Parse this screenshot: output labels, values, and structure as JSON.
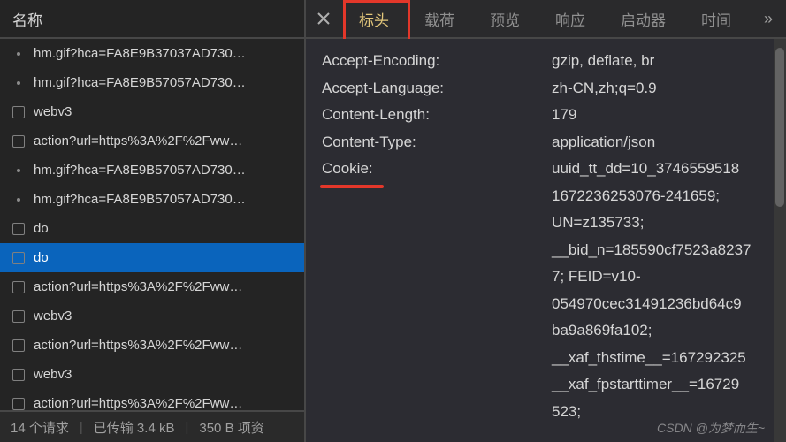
{
  "left": {
    "header": "名称",
    "requests": [
      {
        "icon": "dot",
        "name": "hm.gif?hca=FA8E9B37037AD730…"
      },
      {
        "icon": "dot",
        "name": "hm.gif?hca=FA8E9B57057AD730…"
      },
      {
        "icon": "checkbox",
        "name": "webv3"
      },
      {
        "icon": "checkbox",
        "name": "action?url=https%3A%2F%2Fww…"
      },
      {
        "icon": "dot",
        "name": "hm.gif?hca=FA8E9B57057AD730…"
      },
      {
        "icon": "dot",
        "name": "hm.gif?hca=FA8E9B57057AD730…"
      },
      {
        "icon": "checkbox",
        "name": "do"
      },
      {
        "icon": "checkbox",
        "name": "do",
        "selected": true
      },
      {
        "icon": "checkbox",
        "name": "action?url=https%3A%2F%2Fww…"
      },
      {
        "icon": "checkbox",
        "name": "webv3"
      },
      {
        "icon": "checkbox",
        "name": "action?url=https%3A%2F%2Fww…"
      },
      {
        "icon": "checkbox",
        "name": "webv3"
      },
      {
        "icon": "checkbox",
        "name": "action?url=https%3A%2F%2Fww…"
      }
    ],
    "footer": {
      "requests": "14 个请求",
      "transferred": "已传输 3.4 kB",
      "resources": "350 B 项资"
    }
  },
  "right": {
    "tabs": {
      "headers": "标头",
      "payload": "载荷",
      "preview": "预览",
      "response": "响应",
      "initiator": "启动器",
      "timing": "时间"
    },
    "headers": [
      {
        "name": "Accept-Encoding:",
        "value": "gzip, deflate, br"
      },
      {
        "name": "Accept-Language:",
        "value": "zh-CN,zh;q=0.9"
      },
      {
        "name": "Content-Length:",
        "value": "179"
      },
      {
        "name": "Content-Type:",
        "value": "application/json"
      },
      {
        "name": "Cookie:",
        "value": "uuid_tt_dd=10_3746559518",
        "cookie": true
      }
    ],
    "cookie_lines": [
      "1672236253076-241659;",
      "UN=z135733;",
      "__bid_n=185590cf7523a8237",
      "7; FEID=v10-",
      "054970cec31491236bd64c9",
      "ba9a869fa102;",
      "__xaf_thstime__=167292325",
      "__xaf_fpstarttimer__=16729",
      "523;"
    ]
  },
  "watermark": "CSDN @为梦而生~"
}
